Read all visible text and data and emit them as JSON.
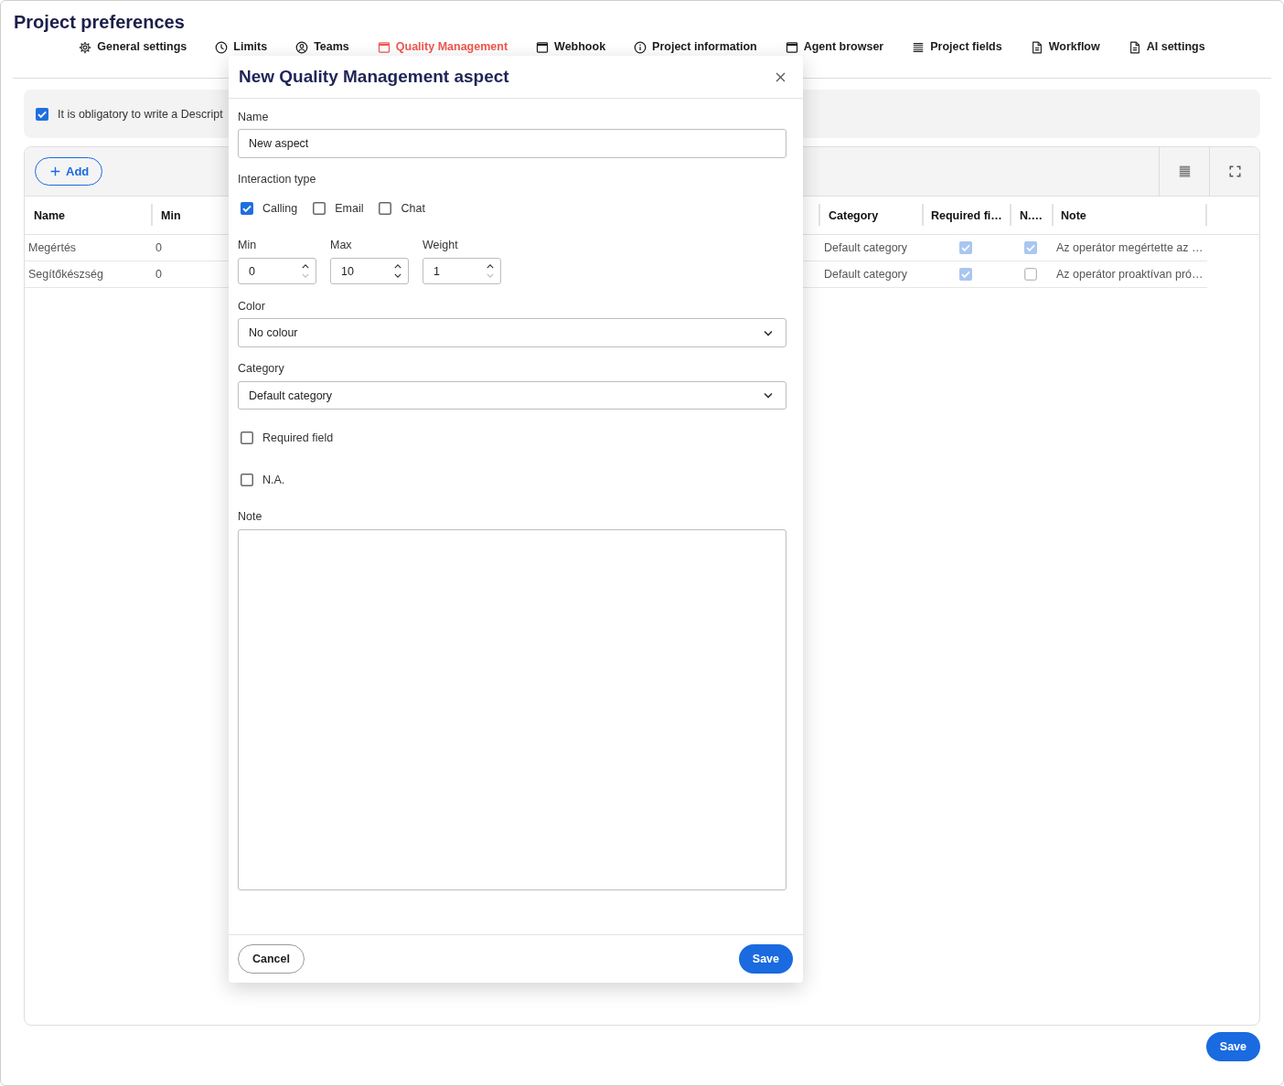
{
  "title": "Project preferences",
  "tabs": [
    {
      "label": "General settings",
      "selected": false
    },
    {
      "label": "Limits",
      "selected": false
    },
    {
      "label": "Teams",
      "selected": false
    },
    {
      "label": "Quality Management",
      "selected": true
    },
    {
      "label": "Webhook",
      "selected": false
    },
    {
      "label": "Project information",
      "selected": false
    },
    {
      "label": "Agent browser",
      "selected": false
    },
    {
      "label": "Project fields",
      "selected": false
    },
    {
      "label": "Workflow",
      "selected": false
    },
    {
      "label": "AI settings",
      "selected": false
    }
  ],
  "banner": {
    "label": "It is obligatory to write a Descript",
    "checked": true
  },
  "table": {
    "add_button": "Add",
    "columns": [
      {
        "label": "Name"
      },
      {
        "label": "Min"
      },
      {
        "label": "Category"
      },
      {
        "label": "Required fi…"
      },
      {
        "label": "N.…"
      },
      {
        "label": "Note"
      }
    ],
    "rows": [
      {
        "name": "Megértés",
        "min": "0",
        "category": "Default category",
        "required": true,
        "na": true,
        "note": "Az operátor megértette az …"
      },
      {
        "name": "Segítőkészség",
        "min": "0",
        "category": "Default category",
        "required": true,
        "na": false,
        "note": "Az operátor proaktívan pró…"
      }
    ]
  },
  "save_button": "Save",
  "dialog": {
    "title": "New Quality Management aspect",
    "name_field": {
      "label": "Name",
      "value": "New aspect"
    },
    "interaction_type": {
      "label": "Interaction type",
      "options": [
        {
          "label": "Calling",
          "checked": true
        },
        {
          "label": "Email",
          "checked": false
        },
        {
          "label": "Chat",
          "checked": false
        }
      ]
    },
    "numbers": [
      {
        "label": "Min",
        "value": "0",
        "decrement_disabled": true
      },
      {
        "label": "Max",
        "value": "10",
        "decrement_disabled": false
      },
      {
        "label": "Weight",
        "value": "1",
        "decrement_disabled": true
      }
    ],
    "color_field": {
      "label": "Color",
      "value": "No colour"
    },
    "category_field": {
      "label": "Category",
      "value": "Default category"
    },
    "toggles": [
      {
        "label": "Required field",
        "checked": false
      },
      {
        "label": "N.A.",
        "checked": false
      }
    ],
    "note_field": {
      "label": "Note"
    },
    "buttons": {
      "cancel": "Cancel",
      "save": "Save"
    }
  }
}
